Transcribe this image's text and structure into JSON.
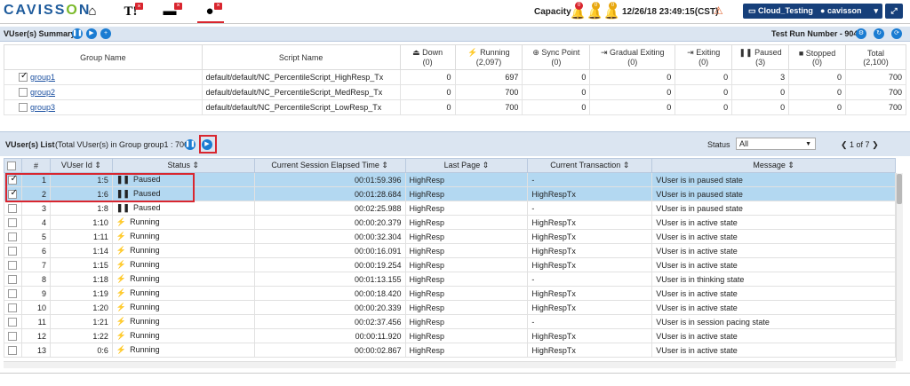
{
  "app": {
    "logo_pre": "CAVISS",
    "logo_o": "O",
    "logo_post": "N"
  },
  "nav": {
    "home_icon": "home-icon",
    "tier_icon": "T!",
    "monitor_icon": "monitor-icon",
    "user_icon": "user-icon"
  },
  "header": {
    "capacity_label": "Capacity",
    "bells": [
      {
        "count": "0",
        "color": "#d9262f"
      },
      {
        "count": "0",
        "color": "#e8a70f"
      },
      {
        "count": "0",
        "color": "#e8a70f"
      }
    ],
    "datetime": "12/26/18 23:49:15(CST)",
    "project_button": "Cloud_Testing",
    "user_button": "cavisson"
  },
  "summary": {
    "title": "VUser(s) Summary",
    "test_run": "Test Run Number - 9045",
    "columns": [
      {
        "label": "Group Name",
        "sub": ""
      },
      {
        "label": "Script Name",
        "sub": ""
      },
      {
        "label": "Down",
        "sub": "(0)"
      },
      {
        "label": "Running",
        "sub": "(2,097)"
      },
      {
        "label": "Sync Point",
        "sub": "(0)"
      },
      {
        "label": "Gradual Exiting",
        "sub": "(0)"
      },
      {
        "label": "Exiting",
        "sub": "(0)"
      },
      {
        "label": "Paused",
        "sub": "(3)"
      },
      {
        "label": "Stopped",
        "sub": "(0)"
      },
      {
        "label": "Total",
        "sub": "(2,100)"
      }
    ],
    "rows": [
      {
        "group": "group1",
        "script": "default/default/NC_PercentileScript_HighResp_Tx",
        "down": "0",
        "running": "697",
        "sync": "0",
        "gradual": "0",
        "exiting": "0",
        "paused": "3",
        "stopped": "0",
        "total": "700",
        "checked": true
      },
      {
        "group": "group2",
        "script": "default/default/NC_PercentileScript_MedResp_Tx",
        "down": "0",
        "running": "700",
        "sync": "0",
        "gradual": "0",
        "exiting": "0",
        "paused": "0",
        "stopped": "0",
        "total": "700",
        "checked": false
      },
      {
        "group": "group3",
        "script": "default/default/NC_PercentileScript_LowResp_Tx",
        "down": "0",
        "running": "700",
        "sync": "0",
        "gradual": "0",
        "exiting": "0",
        "paused": "0",
        "stopped": "0",
        "total": "700",
        "checked": false
      }
    ]
  },
  "list": {
    "title": "VUser(s) List",
    "subtitle": "(Total VUser(s) in Group group1 : 700 )",
    "status_label": "Status",
    "status_value": "All",
    "pager": "1 of 7",
    "columns": [
      "#",
      "VUser Id",
      "Status",
      "Current Session Elapsed Time",
      "Last Page",
      "Current Transaction",
      "Message"
    ],
    "rows": [
      {
        "n": "1",
        "id": "1:5",
        "status": "Paused",
        "elapsed": "00:01:59.396",
        "page": "HighResp",
        "tx": "-",
        "msg": "VUser is in paused state",
        "selected": true
      },
      {
        "n": "2",
        "id": "1:6",
        "status": "Paused",
        "elapsed": "00:01:28.684",
        "page": "HighResp",
        "tx": "HighRespTx",
        "msg": "VUser is in paused state",
        "selected": true
      },
      {
        "n": "3",
        "id": "1:8",
        "status": "Paused",
        "elapsed": "00:02:25.988",
        "page": "HighResp",
        "tx": "-",
        "msg": "VUser is in paused state",
        "selected": false
      },
      {
        "n": "4",
        "id": "1:10",
        "status": "Running",
        "elapsed": "00:00:20.379",
        "page": "HighResp",
        "tx": "HighRespTx",
        "msg": "VUser is in active state",
        "selected": false
      },
      {
        "n": "5",
        "id": "1:11",
        "status": "Running",
        "elapsed": "00:00:32.304",
        "page": "HighResp",
        "tx": "HighRespTx",
        "msg": "VUser is in active state",
        "selected": false
      },
      {
        "n": "6",
        "id": "1:14",
        "status": "Running",
        "elapsed": "00:00:16.091",
        "page": "HighResp",
        "tx": "HighRespTx",
        "msg": "VUser is in active state",
        "selected": false
      },
      {
        "n": "7",
        "id": "1:15",
        "status": "Running",
        "elapsed": "00:00:19.254",
        "page": "HighResp",
        "tx": "HighRespTx",
        "msg": "VUser is in active state",
        "selected": false
      },
      {
        "n": "8",
        "id": "1:18",
        "status": "Running",
        "elapsed": "00:01:13.155",
        "page": "HighResp",
        "tx": "-",
        "msg": "VUser is in thinking state",
        "selected": false
      },
      {
        "n": "9",
        "id": "1:19",
        "status": "Running",
        "elapsed": "00:00:18.420",
        "page": "HighResp",
        "tx": "HighRespTx",
        "msg": "VUser is in active state",
        "selected": false
      },
      {
        "n": "10",
        "id": "1:20",
        "status": "Running",
        "elapsed": "00:00:20.339",
        "page": "HighResp",
        "tx": "HighRespTx",
        "msg": "VUser is in active state",
        "selected": false
      },
      {
        "n": "11",
        "id": "1:21",
        "status": "Running",
        "elapsed": "00:02:37.456",
        "page": "HighResp",
        "tx": "-",
        "msg": "VUser is in session pacing state",
        "selected": false
      },
      {
        "n": "12",
        "id": "1:22",
        "status": "Running",
        "elapsed": "00:00:11.920",
        "page": "HighResp",
        "tx": "HighRespTx",
        "msg": "VUser is in active state",
        "selected": false
      },
      {
        "n": "13",
        "id": "0:6",
        "status": "Running",
        "elapsed": "00:00:02.867",
        "page": "HighResp",
        "tx": "HighRespTx",
        "msg": "VUser is in active state",
        "selected": false
      }
    ]
  }
}
